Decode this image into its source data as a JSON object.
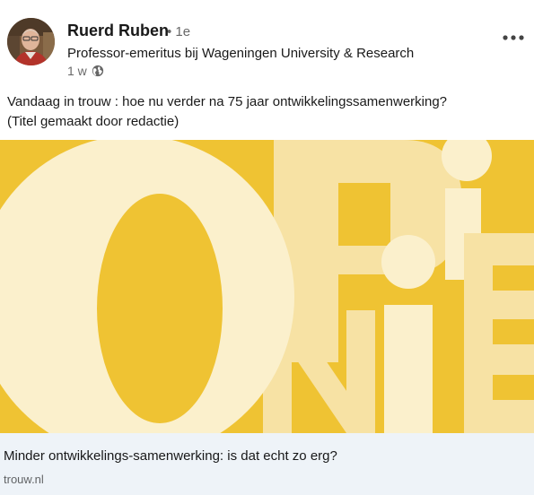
{
  "author": {
    "name": "Ruerd Ruben",
    "degree": "• 1e",
    "headline": "Professor-emeritus bij Wageningen University & Research",
    "time": "1 w",
    "avatar_icon": "profile-photo"
  },
  "post": {
    "line1": "Vandaag in trouw : hoe nu verder na 75 jaar ontwikkelingssamenwerking?",
    "line2": "(Titel gemaakt door redactie)"
  },
  "article": {
    "image_letters": "OPINIE",
    "title": "Minder ontwikkelings-samenwerking: is dat echt zo erg?",
    "source": "trouw.nl"
  },
  "icons": {
    "visibility": "globe-icon",
    "menu": "more-options-icon"
  },
  "colors": {
    "image_background": "#efc333",
    "letter_light": "#fbf0cc",
    "letter_mid": "#f7e2a4",
    "link_footer_bg": "#eef3f8"
  }
}
